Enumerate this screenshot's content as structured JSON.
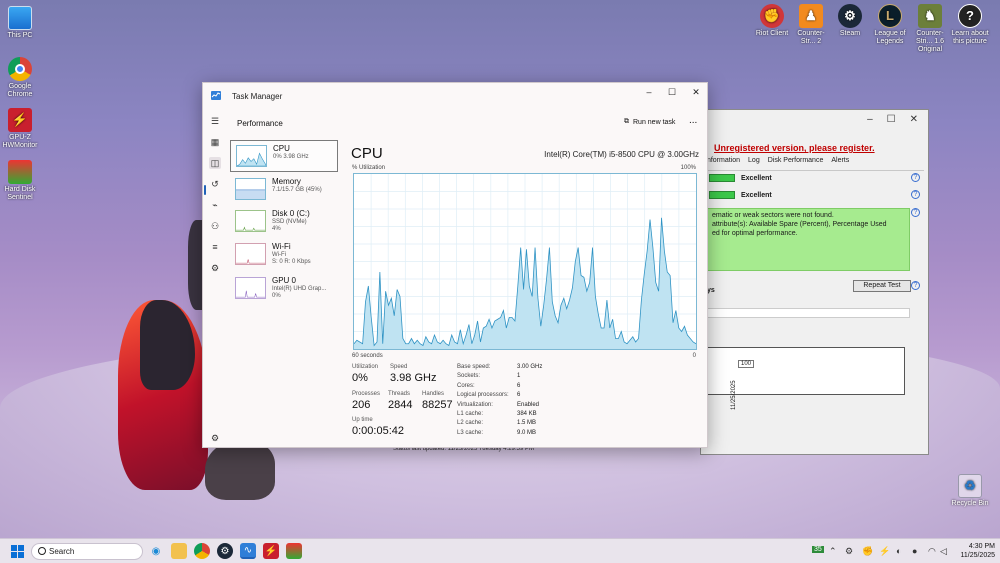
{
  "desktop": {
    "left_icons": [
      {
        "label": "This PC",
        "icon": "this-pc-icon"
      },
      {
        "label": "Google Chrome",
        "icon": "chrome-icon"
      },
      {
        "label": "GPU-Z HWMonitor",
        "icon": "hwmonitor-icon"
      },
      {
        "label": "Hard Disk Sentinel",
        "icon": "hard-disk-sentinel-icon"
      }
    ],
    "top_icons": [
      {
        "label": "Riot Client",
        "icon": "riot-client-icon",
        "color": "#d13639"
      },
      {
        "label": "Counter-Str... 2",
        "icon": "counter-strike-2-icon",
        "color": "#f28a1e"
      },
      {
        "label": "Steam",
        "icon": "steam-icon",
        "color": "#1b2838"
      },
      {
        "label": "League of Legends",
        "icon": "league-of-legends-icon",
        "color": "#c8aa6e"
      },
      {
        "label": "Counter-Stri... 1.6 Original",
        "icon": "counter-strike-16-icon",
        "color": "#6c7f3a"
      },
      {
        "label": "Learn about this picture",
        "icon": "learn-picture-icon",
        "color": "#222222"
      }
    ],
    "recycle_bin": "Recycle Bin"
  },
  "hds": {
    "unregistered": "Unregistered version, please register.",
    "tabs": [
      "Information",
      "Log",
      "Disk Performance",
      "Alerts"
    ],
    "rows": [
      {
        "label": "Excellent"
      },
      {
        "label": "Excellent"
      }
    ],
    "message_lines": [
      "ematic or weak sectors were not found.",
      "attribute(s): Available Spare (Percent), Percentage Used",
      "ed for optimal performance."
    ],
    "repeat_test": "Repeat Test",
    "days_label": "ys",
    "graph_value": "100",
    "graph_date": "11/25/2025",
    "status": "Status last updated: 11/25/2025 Tuesday 4:29:59 PM"
  },
  "taskmanager": {
    "title": "Task Manager",
    "section": "Performance",
    "run_new_task": "Run new task",
    "more": "...",
    "controls": {
      "min": "–",
      "max": "☐",
      "close": "✕"
    },
    "devices": [
      {
        "name": "CPU",
        "line1": "0% 3.98 GHz",
        "line2": ""
      },
      {
        "name": "Memory",
        "line1": "7.1/15.7 GB (45%)",
        "line2": ""
      },
      {
        "name": "Disk 0 (C:)",
        "line1": "SSD (NVMe)",
        "line2": "4%"
      },
      {
        "name": "Wi-Fi",
        "line1": "Wi-Fi",
        "line2": "S: 0 R: 0 Kbps"
      },
      {
        "name": "GPU 0",
        "line1": "Intel(R) UHD Grap...",
        "line2": "0%"
      }
    ],
    "cpu": {
      "title": "CPU",
      "model": "Intel(R) Core(TM) i5-8500 CPU @ 3.00GHz",
      "util_label": "% Utilization",
      "max_label": "100%",
      "time_label": "60 seconds",
      "min_label": "0",
      "graph_percent": [
        3,
        5,
        4,
        3,
        27,
        36,
        18,
        2,
        4,
        44,
        3,
        33,
        25,
        29,
        19,
        34,
        30,
        6,
        3,
        3,
        6,
        3,
        5,
        3,
        2,
        7,
        4,
        3,
        8,
        4,
        3,
        5,
        3,
        2,
        8,
        4,
        3,
        11,
        3,
        8,
        14,
        3,
        8,
        16,
        4,
        12,
        13,
        17,
        12,
        16,
        17,
        18,
        22,
        12,
        18,
        18,
        16,
        36,
        58,
        34,
        57,
        36,
        30,
        58,
        29,
        13,
        25,
        40,
        58,
        27,
        19,
        15,
        25,
        29,
        23,
        28,
        35,
        50,
        58,
        42,
        41,
        33,
        38,
        58,
        30,
        20,
        12,
        12,
        28,
        12,
        17,
        6,
        6,
        10,
        4,
        3,
        5,
        7,
        4,
        6,
        28,
        43,
        56,
        74,
        58,
        38,
        33,
        75,
        56,
        44,
        42,
        15,
        22,
        12,
        10,
        13,
        8,
        6,
        4,
        3
      ],
      "stats": {
        "utilization_label": "Utilization",
        "utilization": "0%",
        "speed_label": "Speed",
        "speed": "3.98 GHz",
        "processes_label": "Processes",
        "processes": "206",
        "threads_label": "Threads",
        "threads": "2844",
        "handles_label": "Handles",
        "handles": "88257",
        "uptime_label": "Up time",
        "uptime": "0:00:05:42"
      },
      "props": [
        {
          "k": "Base speed:",
          "v": "3.00 GHz"
        },
        {
          "k": "Sockets:",
          "v": "1"
        },
        {
          "k": "Cores:",
          "v": "6"
        },
        {
          "k": "Logical processors:",
          "v": "6"
        },
        {
          "k": "Virtualization:",
          "v": "Enabled"
        },
        {
          "k": "L1 cache:",
          "v": "384 KB"
        },
        {
          "k": "L2 cache:",
          "v": "1.5 MB"
        },
        {
          "k": "L3 cache:",
          "v": "9.0 MB"
        }
      ]
    }
  },
  "taskbar": {
    "search_placeholder": "Search",
    "tray_badge": "35",
    "time": "4:30 PM",
    "date": "11/25/2025"
  },
  "colors": {
    "cpu_line": "#2f93c4",
    "cpu_fill": "#bfe3f2",
    "accent": "#2062b8"
  }
}
